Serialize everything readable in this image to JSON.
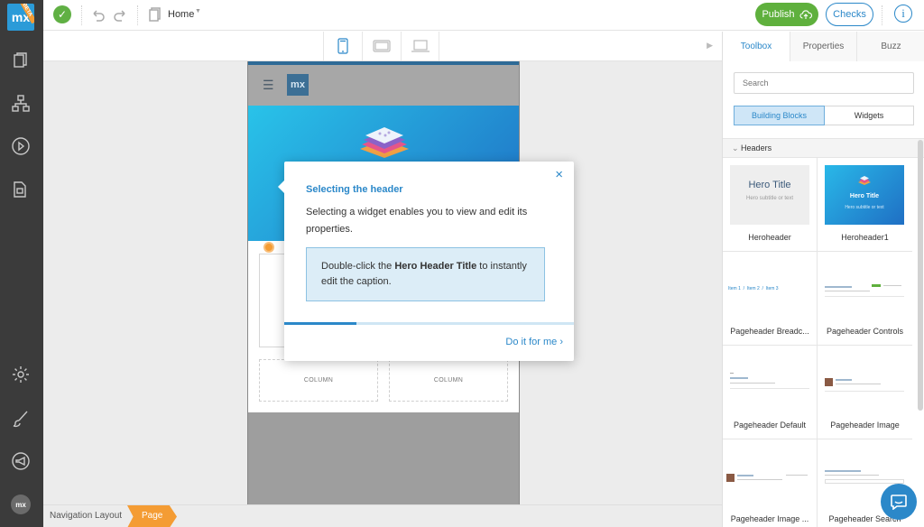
{
  "rail": {
    "logo_text": "mx",
    "beta_badge": "BETA",
    "avatar_text": "mx",
    "icons": [
      "pages-icon",
      "structure-icon",
      "run-icon",
      "documents-icon",
      "settings-icon",
      "brush-icon",
      "announcement-icon"
    ]
  },
  "topbar": {
    "document_name": "Home",
    "publish_label": "Publish",
    "checks_label": "Checks",
    "info_label": "i"
  },
  "canvas": {
    "column_label_1": "COLUMN",
    "column_label_2": "COLUMN",
    "mini_logo": "mx"
  },
  "dialog": {
    "title": "Selecting the header",
    "body": "Selecting a widget enables you to view and edit its properties.",
    "hint_prefix": "Double-click the ",
    "hint_bold": "Hero Header Title",
    "hint_suffix": " to instantly edit the caption.",
    "action": "Do it for me",
    "progress": 0.25
  },
  "breadcrumb": {
    "item1": "Navigation Layout",
    "item2": "Page"
  },
  "panel": {
    "tabs": [
      "Toolbox",
      "Properties",
      "Buzz"
    ],
    "search_placeholder": "Search",
    "seg_building": "Building Blocks",
    "seg_widgets": "Widgets",
    "section": "Headers",
    "cards": [
      "Heroheader",
      "Heroheader1",
      "Pageheader Breadc...",
      "Pageheader Controls",
      "Pageheader Default",
      "Pageheader Image",
      "Pageheader Image ...",
      "Pageheader Search"
    ],
    "hero_thumb_title": "Hero Title",
    "hero_thumb_sub": "Hero subtitle or text",
    "hero1_thumb_title": "Hero Title",
    "hero1_thumb_sub": "Hero subtitle or text",
    "breadcrumb_thumb": "Item 1  /  Item 2  /  Item 3"
  },
  "colors": {
    "accent": "#2b88c9",
    "publish": "#5fb03d",
    "orange": "#f49c34"
  }
}
